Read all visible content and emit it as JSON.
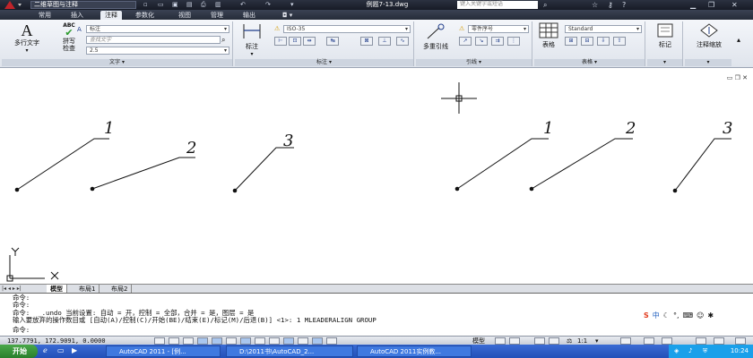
{
  "titlebar": {
    "workspace": "二维草图与注释",
    "document_title": "例题7-13.dwg",
    "search_placeholder": "键入关键字或短语"
  },
  "tabs": [
    "常用",
    "插入",
    "注释",
    "参数化",
    "视图",
    "管理",
    "输出"
  ],
  "active_tab": "注释",
  "ribbon": {
    "text_panel": {
      "title": "文字",
      "mtext_label": "多行文字",
      "spell_label_1": "拼写",
      "spell_label_2": "检查",
      "abc_icon_text": "ABC",
      "style_value": "标注",
      "find_placeholder": "查找文字",
      "height_value": "2.5"
    },
    "dim_panel": {
      "title": "标注",
      "dim_label": "标注",
      "dimstyle_value": "ISO-35"
    },
    "leader_panel": {
      "title": "引线",
      "mleader_label": "多重引线",
      "mleader_style_value": "零件序号"
    },
    "table_panel": {
      "title": "表格",
      "table_label": "表格",
      "table_style_value": "Standard"
    },
    "markup_panel": {
      "title": "",
      "label": "标记"
    },
    "scale_panel": {
      "title": "",
      "label": "注释缩放"
    }
  },
  "drawing": {
    "leader_labels": [
      "1",
      "2",
      "3",
      "1",
      "2",
      "3"
    ]
  },
  "layout_tabs": [
    "模型",
    "布局1",
    "布局2"
  ],
  "active_layout": "模型",
  "command_lines": [
    "命令:",
    "命令:",
    "命令:  _.undo 当前设置: 自动 = 开，控制 = 全部，合并 = 是，图层 = 是",
    "输入要放弃的操作数目或 [自动(A)/控制(C)/开始(BE)/结束(E)/标记(M)/后退(B)] <1>: 1 MLEADERALIGN GROUP",
    "命令:"
  ],
  "status": {
    "coordinates": "137.7791, 172.9091, 0.0000",
    "model_label": "模型",
    "annotation_scale": "1:1"
  },
  "taskbar": {
    "start_label": "开始",
    "tasks": [
      "AutoCAD 2011 - [例...",
      "D:\\2011书\\AutoCAD_2...",
      "AutoCAD 2011实例教..."
    ],
    "clock": "10:24"
  },
  "colors": {
    "titlebar_bg": "#1d2230",
    "ribbon_bg": "#e6eaf1",
    "taskbar_bg": "#2c5bc4",
    "start_green": "#3a9a3c"
  }
}
